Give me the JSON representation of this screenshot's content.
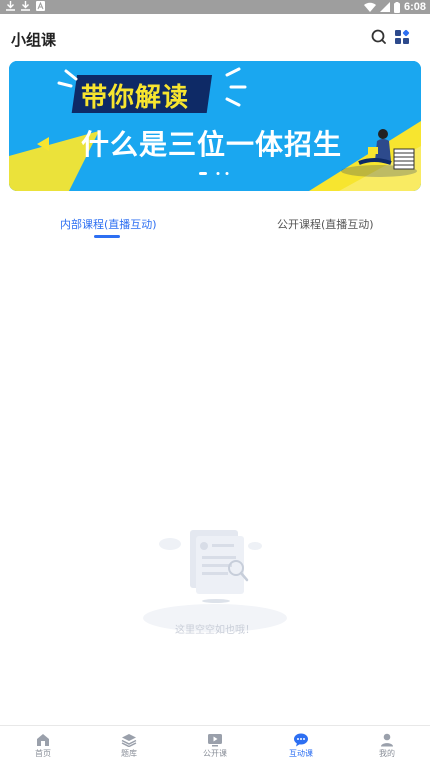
{
  "status_bar": {
    "time": "6:08"
  },
  "header": {
    "title": "小组课"
  },
  "banner": {
    "headline_1": "带你解读",
    "headline_2": "什么是三位一体招生"
  },
  "tabs": [
    {
      "label": "内部课程(直播互动)"
    },
    {
      "label": "公开课程(直播互动)"
    }
  ],
  "empty_state": {
    "message": "这里空空如也哦！"
  },
  "bottom_nav": [
    {
      "label": "首页",
      "icon": "home-icon"
    },
    {
      "label": "题库",
      "icon": "layers-icon"
    },
    {
      "label": "公开课",
      "icon": "video-icon"
    },
    {
      "label": "互动课",
      "icon": "chat-icon"
    },
    {
      "label": "我的",
      "icon": "user-icon"
    }
  ],
  "colors": {
    "accent": "#2d6ff2",
    "banner_blue": "#1aa7f0",
    "banner_yellow": "#f7e52f",
    "statusbar": "#9e9e9e"
  }
}
